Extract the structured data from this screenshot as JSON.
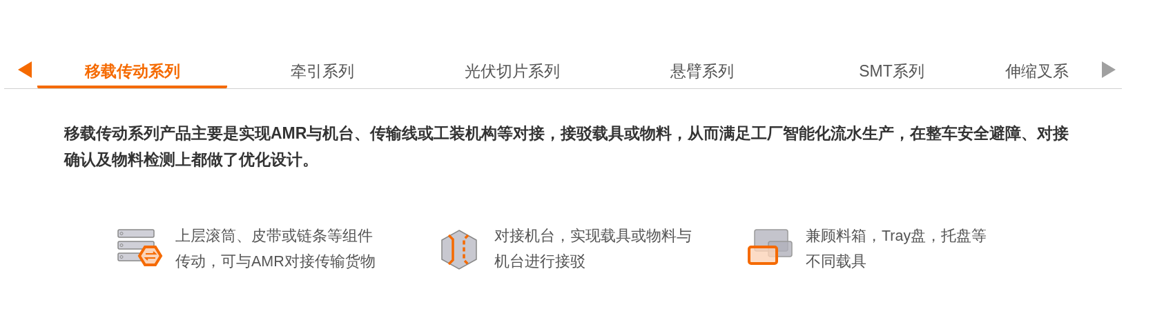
{
  "tabs": [
    {
      "label": "移载传动系列",
      "selected": true
    },
    {
      "label": "牵引系列",
      "selected": false
    },
    {
      "label": "光伏切片系列",
      "selected": false
    },
    {
      "label": "悬臂系列",
      "selected": false
    },
    {
      "label": "SMT系列",
      "selected": false
    },
    {
      "label": "伸缩叉系",
      "selected": false
    }
  ],
  "description": "移载传动系列产品主要是实现AMR与机台、传输线或工装机构等对接，接驳载具或物料，从而满足工厂智能化流水生产，在整车安全避障、对接确认及物料检测上都做了优化设计。",
  "features": [
    {
      "kind": "rollers",
      "text": "上层滚筒、皮带或链条等组件传动，可与AMR对接传输货物"
    },
    {
      "kind": "docking",
      "text": "对接机台，实现载具或物料与机台进行接驳"
    },
    {
      "kind": "carriers",
      "text": "兼顾料箱，Tray盘，托盘等不同载具"
    }
  ]
}
